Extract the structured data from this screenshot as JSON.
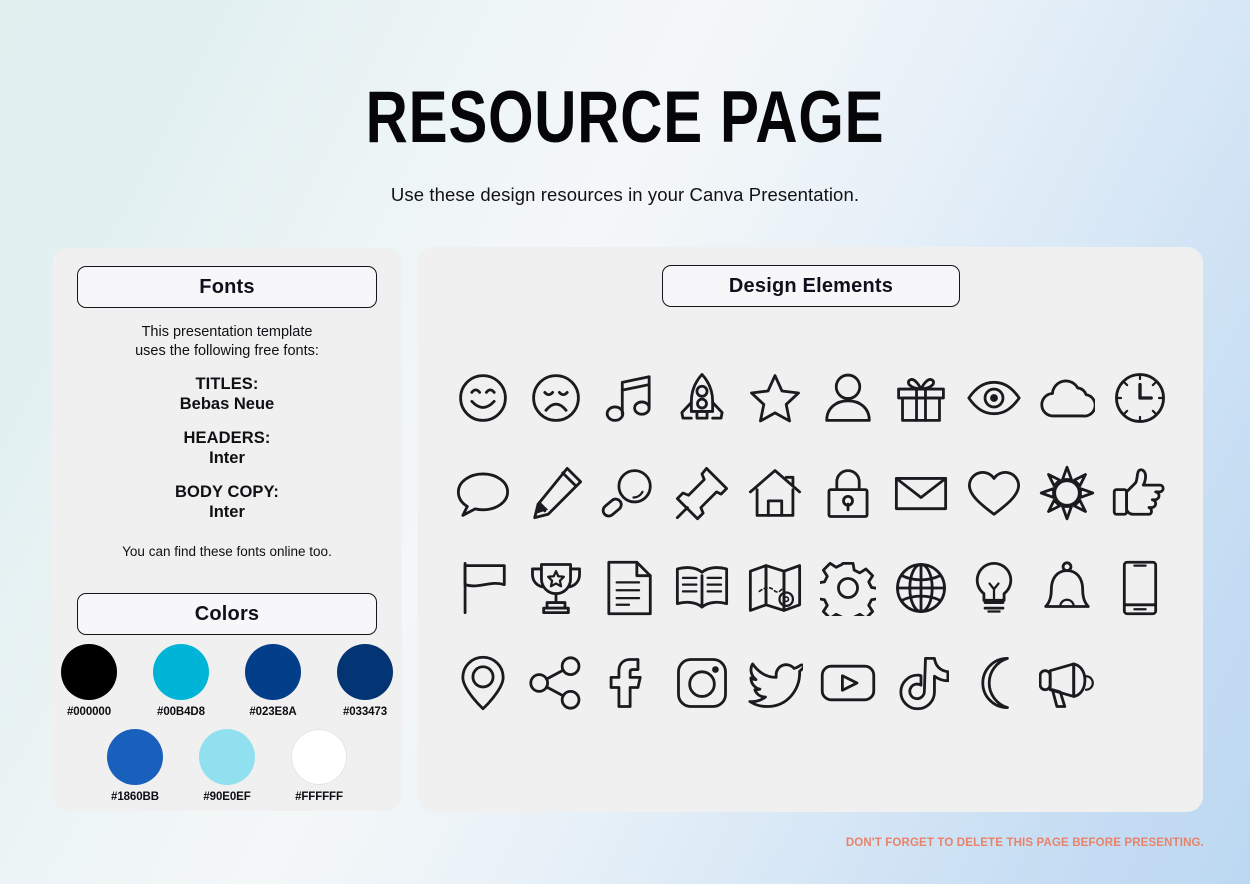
{
  "header": {
    "title": "RESOURCE PAGE",
    "subtitle": "Use these design resources in your Canva Presentation."
  },
  "fonts_panel": {
    "pill_label": "Fonts",
    "intro_line1": "This presentation template",
    "intro_line2": "uses the following free fonts:",
    "groups": [
      {
        "role": "TITLES:",
        "name": "Bebas Neue"
      },
      {
        "role": "HEADERS:",
        "name": "Inter"
      },
      {
        "role": "BODY COPY:",
        "name": "Inter"
      }
    ],
    "footnote": "You can find these fonts online too."
  },
  "colors_panel": {
    "pill_label": "Colors",
    "row1": [
      {
        "hex": "#000000",
        "label": "#000000"
      },
      {
        "hex": "#00B4D8",
        "label": "#00B4D8"
      },
      {
        "hex": "#023E8A",
        "label": "#023E8A"
      },
      {
        "hex": "#033473",
        "label": "#033473"
      }
    ],
    "row2": [
      {
        "hex": "#1860BB",
        "label": "#1860BB"
      },
      {
        "hex": "#90E0EF",
        "label": "#90E0EF"
      },
      {
        "hex": "#FFFFFF",
        "label": "#FFFFFF"
      }
    ]
  },
  "elements_panel": {
    "pill_label": "Design Elements",
    "icons": [
      "smiley-face-icon",
      "sad-face-icon",
      "music-note-icon",
      "rocket-icon",
      "star-icon",
      "person-icon",
      "gift-icon",
      "eye-icon",
      "cloud-icon",
      "clock-icon",
      "speech-bubble-icon",
      "pencil-icon",
      "magnifier-icon",
      "pushpin-icon",
      "house-icon",
      "lock-icon",
      "envelope-icon",
      "heart-icon",
      "sun-icon",
      "thumbs-up-icon",
      "flag-icon",
      "trophy-icon",
      "document-icon",
      "book-icon",
      "map-icon",
      "gear-icon",
      "globe-icon",
      "lightbulb-icon",
      "bell-icon",
      "phone-icon",
      "location-pin-icon",
      "share-icon",
      "facebook-icon",
      "instagram-icon",
      "twitter-icon",
      "youtube-icon",
      "tiktok-icon",
      "moon-icon",
      "megaphone-icon"
    ]
  },
  "footer": {
    "note": "DON'T FORGET TO DELETE THIS PAGE BEFORE PRESENTING."
  }
}
